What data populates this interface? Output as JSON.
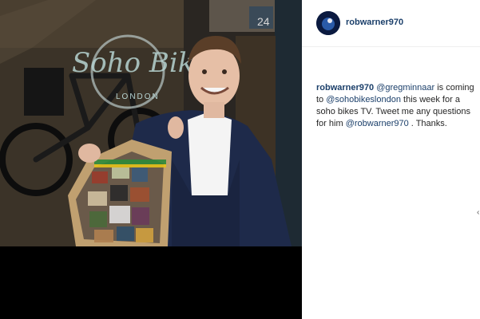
{
  "post": {
    "author": "robwarner970",
    "caption": {
      "author": "robwarner970",
      "mention1": "@gregminnaar",
      "text1": " is coming to ",
      "mention2": "@sohobikeslondon",
      "text2": " this week for a soho bikes TV. Tweet me any questions for him ",
      "mention3": "@robwarner970",
      "text3": " . Thanks."
    }
  },
  "photo": {
    "shop_sign": "Soho Bikes",
    "shop_sign_sub": "LONDON",
    "door_number": "24"
  },
  "colors": {
    "link": "#1b3f6a",
    "text": "#262626",
    "divider": "#efefef"
  },
  "icons": {
    "more": "chevron-right-icon"
  }
}
